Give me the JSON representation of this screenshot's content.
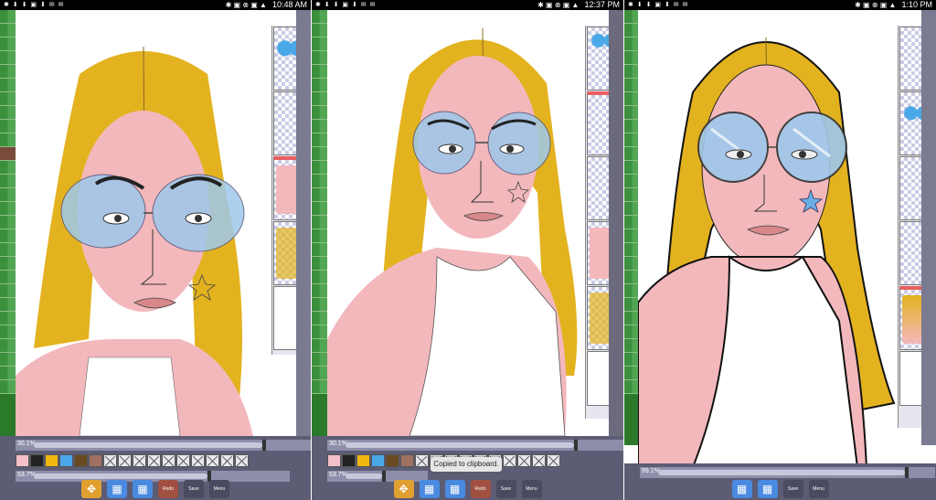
{
  "panels": [
    {
      "time": "10:48 AM",
      "battery": "▮"
    },
    {
      "time": "12:37 PM",
      "battery": "▮"
    },
    {
      "time": "1:10 PM",
      "battery": "▮"
    }
  ],
  "statusbar": {
    "left_icons": "✱ ⬇ ⬇ ▣ ⬇ ✉ ✉",
    "right_icons": "✱ ▣ ⊗ ▣ ▲"
  },
  "toast": {
    "text": "Copied to clipboard."
  },
  "toolbar": {
    "slider1_label": "30.1%",
    "slider2_label": "53.7%",
    "slider3_label": "99.1%",
    "btn_cursor": "✥",
    "btn_layers_a": "▦",
    "btn_layers_b": "▦",
    "btn_redo": "Redo",
    "btn_save": "Save",
    "btn_menu": "Menu"
  },
  "colors": {
    "swatches": [
      "#f4c0c8",
      "#222222",
      "#f0b810",
      "#4aa8e8",
      "#6a4a20",
      "#a07060"
    ],
    "hair": "#e3b21f",
    "skin": "#f3b8bc",
    "lens": "#9ec8ec"
  }
}
